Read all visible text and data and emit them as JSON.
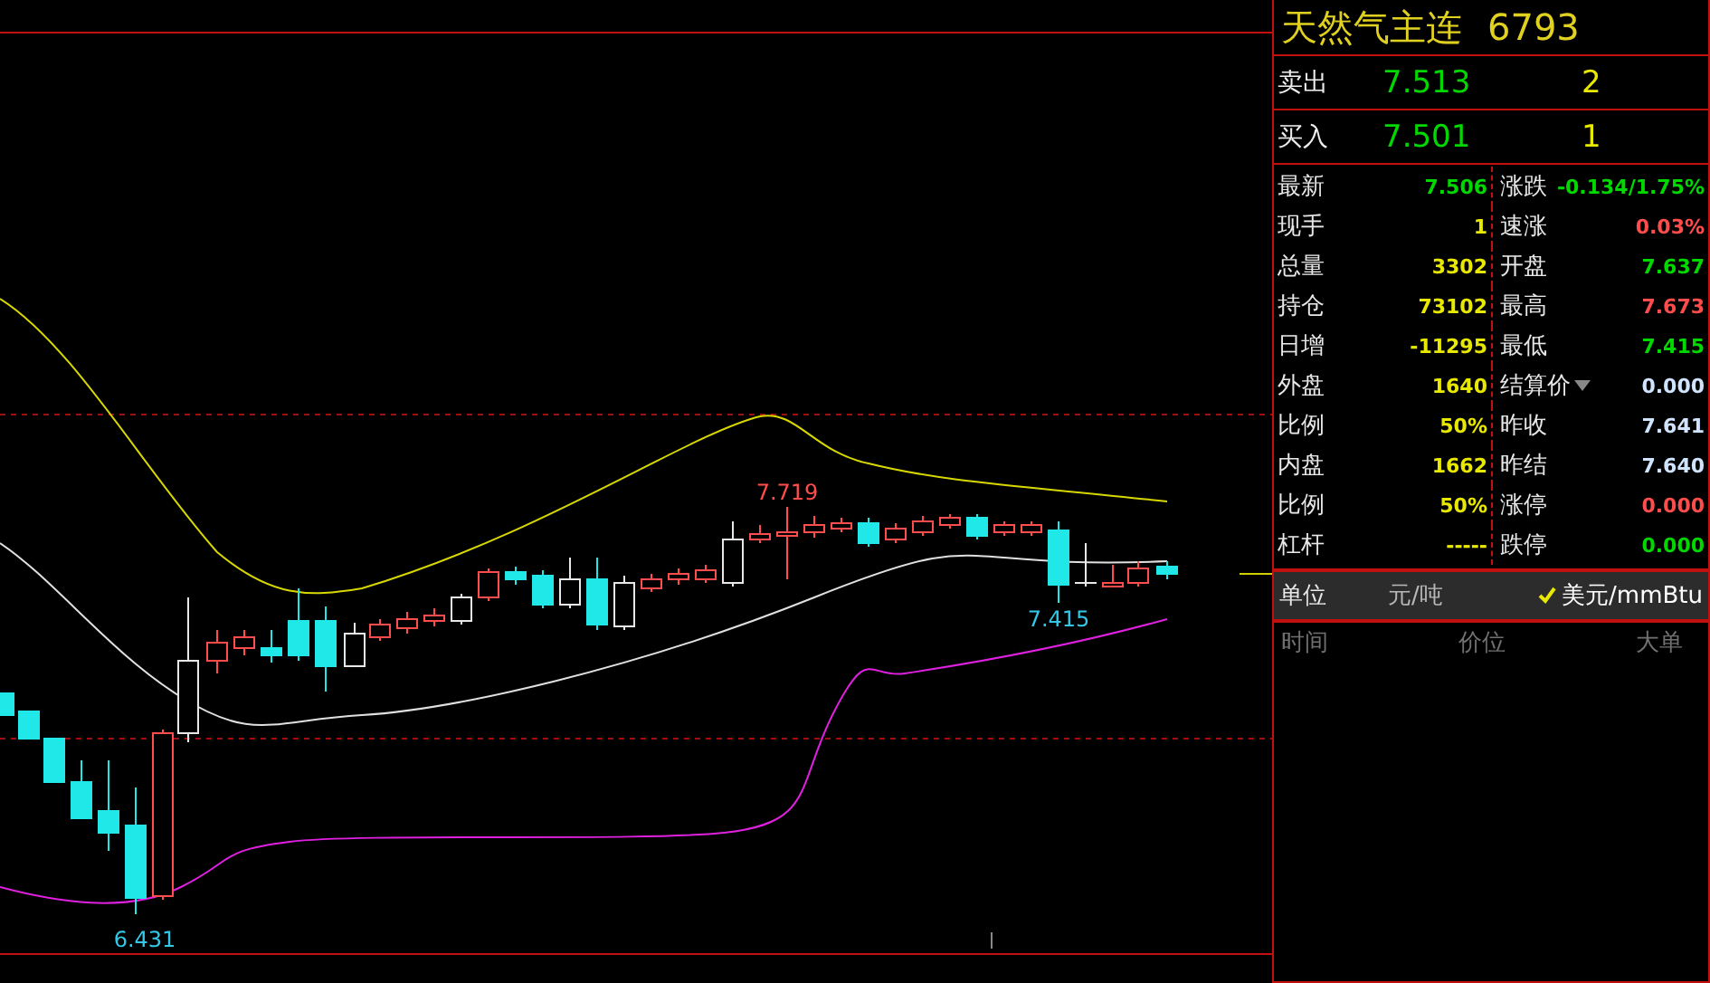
{
  "chart": {
    "price_labels": [
      {
        "text": "7.719",
        "color": "#ff4c4c"
      },
      {
        "text": "7.415",
        "color": "#34c8e8"
      },
      {
        "text": "6.431",
        "color": "#34c8e8"
      }
    ]
  },
  "quote_panel": {
    "title": "天然气主连",
    "code": "6793",
    "order_book": [
      {
        "label": "卖出",
        "price": "7.513",
        "volume": "2"
      },
      {
        "label": "买入",
        "price": "7.501",
        "volume": "1"
      }
    ],
    "stats": [
      [
        {
          "label": "最新",
          "value": "7.506",
          "color": "#00d800",
          "kind": "plain"
        },
        {
          "label": "涨跌",
          "value": "-0.134/1.75%",
          "color": "#00d800",
          "kind": "plain"
        }
      ],
      [
        {
          "label": "现手",
          "value": "1",
          "color": "#e8e800",
          "kind": "plain"
        },
        {
          "label": "速涨",
          "value": "0.03%",
          "color": "#ff4c4c",
          "kind": "plain"
        }
      ],
      [
        {
          "label": "总量",
          "value": "3302",
          "color": "#e8e800",
          "kind": "plain"
        },
        {
          "label": "开盘",
          "value": "7.637",
          "color": "#00d800",
          "kind": "plain"
        }
      ],
      [
        {
          "label": "持仓",
          "value": "73102",
          "color": "#e8e800",
          "kind": "plain"
        },
        {
          "label": "最高",
          "value": "7.673",
          "color": "#ff4c4c",
          "kind": "plain"
        }
      ],
      [
        {
          "label": "日增",
          "value": "-11295",
          "color": "#e8e800",
          "kind": "plain"
        },
        {
          "label": "最低",
          "value": "7.415",
          "color": "#00d800",
          "kind": "plain"
        }
      ],
      [
        {
          "label": "外盘",
          "value": "1640",
          "color": "#e8e800",
          "kind": "plain"
        },
        {
          "label": "结算价",
          "value": "0.000",
          "color": "#d0e4ff",
          "kind": "dropdown"
        }
      ],
      [
        {
          "label": "比例",
          "value": "50%",
          "color": "#e8e800",
          "kind": "plain"
        },
        {
          "label": "昨收",
          "value": "7.641",
          "color": "#d0e4ff",
          "kind": "plain"
        }
      ],
      [
        {
          "label": "内盘",
          "value": "1662",
          "color": "#e8e800",
          "kind": "plain"
        },
        {
          "label": "昨结",
          "value": "7.640",
          "color": "#d0e4ff",
          "kind": "plain"
        }
      ],
      [
        {
          "label": "比例",
          "value": "50%",
          "color": "#e8e800",
          "kind": "plain"
        },
        {
          "label": "涨停",
          "value": "0.000",
          "color": "#ff4c4c",
          "kind": "plain"
        }
      ],
      [
        {
          "label": "杠杆",
          "value": "-----",
          "color": "#e8e800",
          "kind": "plain"
        },
        {
          "label": "跌停",
          "value": "0.000",
          "color": "#00d800",
          "kind": "plain"
        }
      ]
    ],
    "units": {
      "label": "单位",
      "options": [
        {
          "label": "元/吨",
          "selected": false
        },
        {
          "label": "美元/mmBtu",
          "selected": true
        }
      ]
    },
    "tick_columns": [
      "时间",
      "价位",
      "大单"
    ]
  }
}
